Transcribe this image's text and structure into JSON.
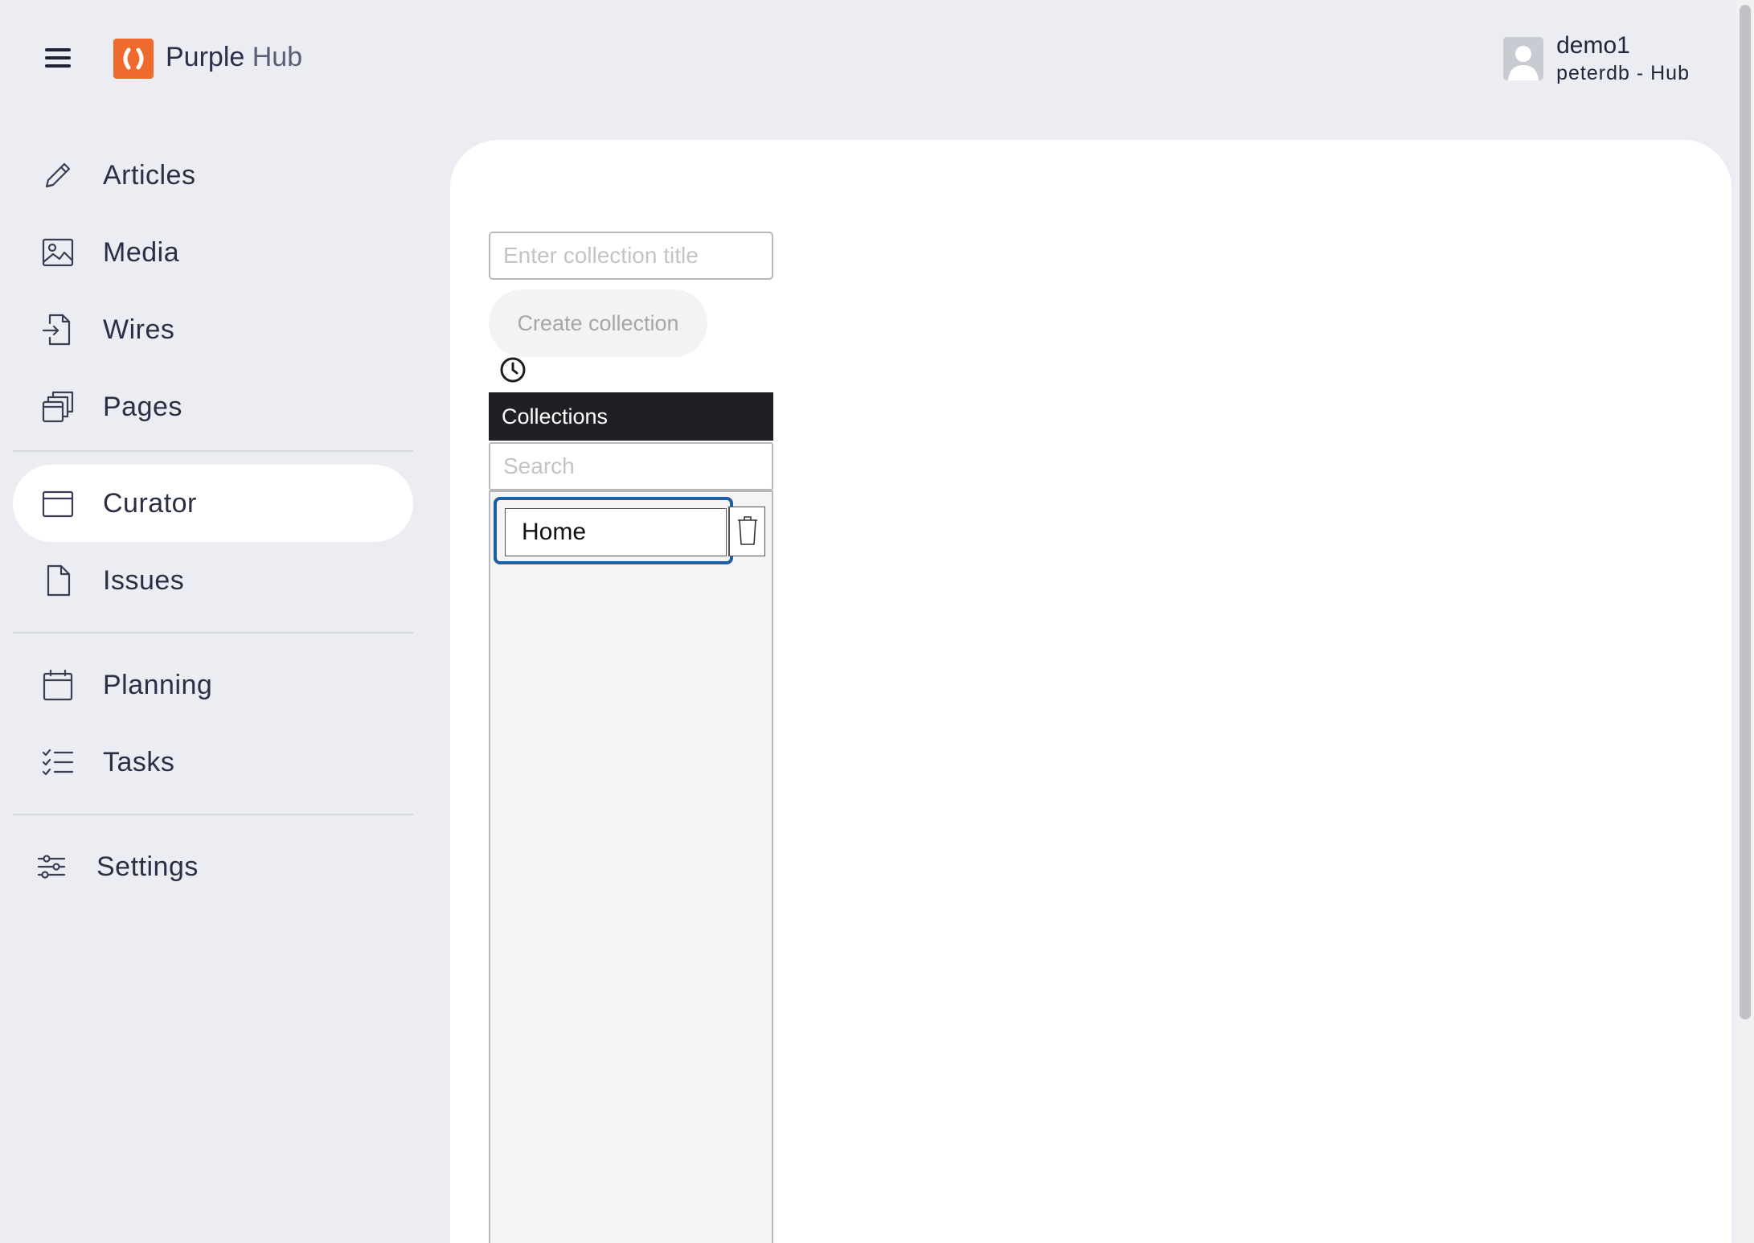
{
  "header": {
    "brand_primary": "Purple",
    "brand_secondary": "Hub",
    "user_name": "demo1",
    "user_workspace": "peterdb - Hub"
  },
  "sidebar": {
    "items": [
      {
        "label": "Articles",
        "icon": "pencil-icon"
      },
      {
        "label": "Media",
        "icon": "image-icon"
      },
      {
        "label": "Wires",
        "icon": "import-file-icon"
      },
      {
        "label": "Pages",
        "icon": "stacked-pages-icon"
      },
      {
        "label": "Curator",
        "icon": "browser-window-icon",
        "active": true
      },
      {
        "label": "Issues",
        "icon": "document-icon"
      },
      {
        "label": "Planning",
        "icon": "calendar-icon"
      },
      {
        "label": "Tasks",
        "icon": "checklist-icon"
      },
      {
        "label": "Settings",
        "icon": "sliders-icon"
      }
    ]
  },
  "curator": {
    "title_placeholder": "Enter collection title",
    "create_label": "Create collection",
    "collections_header": "Collections",
    "search_placeholder": "Search",
    "collections": [
      {
        "label": "Home"
      }
    ]
  },
  "colors": {
    "accent_logo": "#ef6a2c",
    "background": "#ebedf3",
    "selection_outline": "#1f5e9f",
    "header_dark": "#1f2023"
  }
}
